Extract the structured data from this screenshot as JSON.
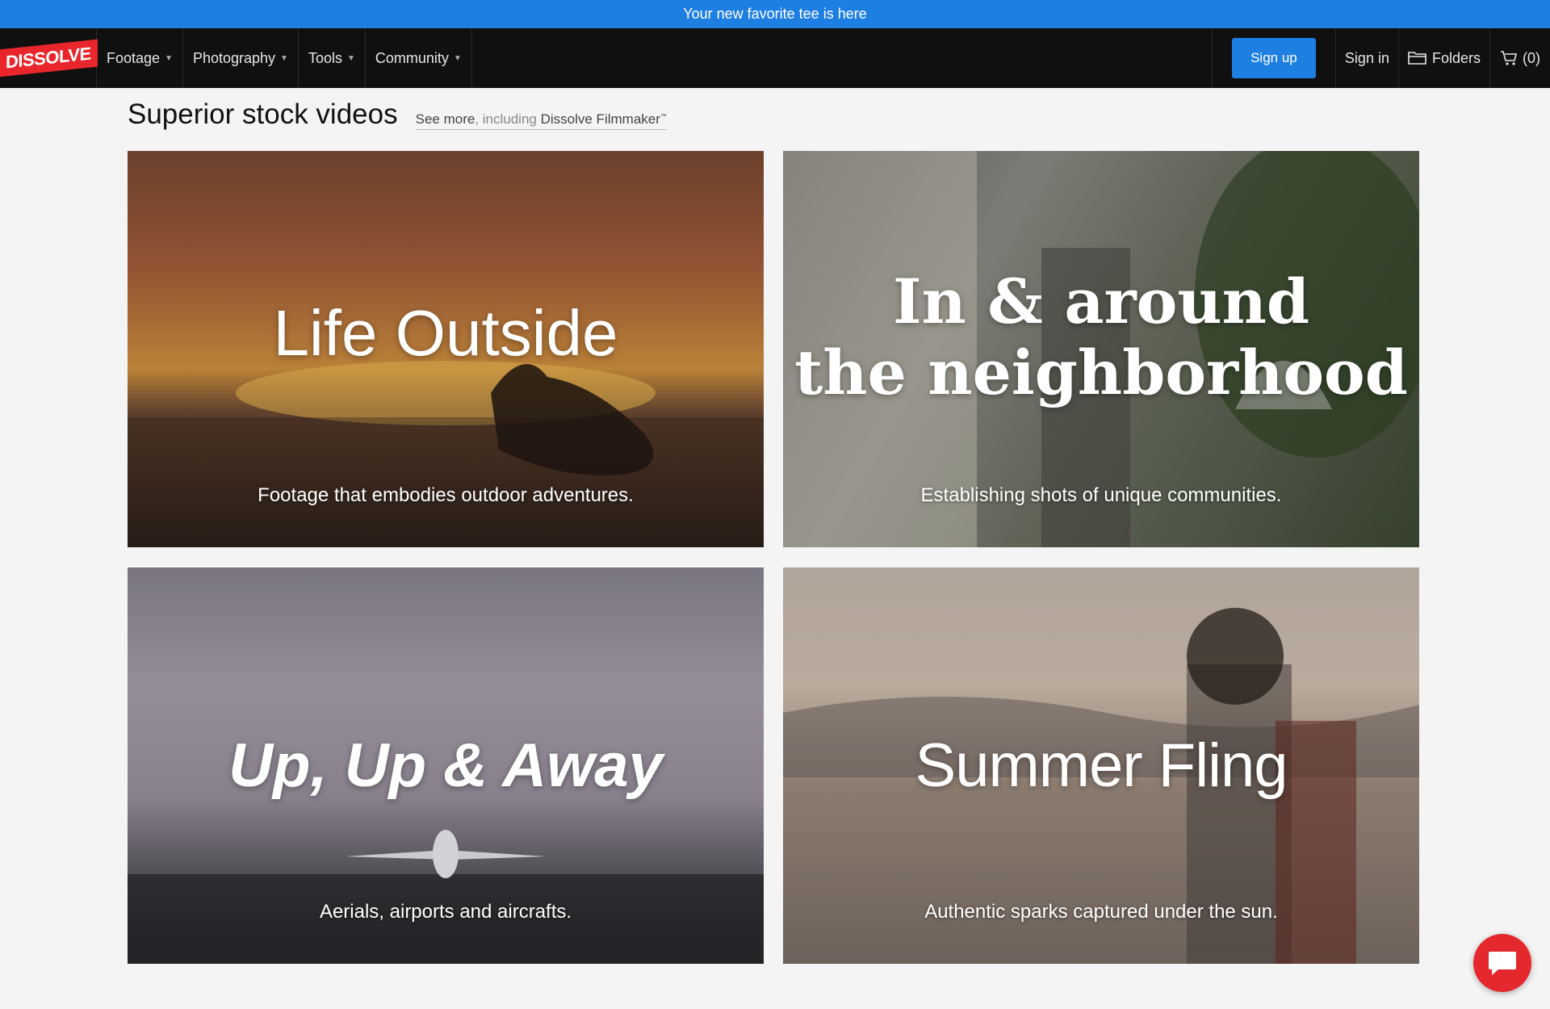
{
  "promo": {
    "text": "Your new favorite tee is here"
  },
  "nav": {
    "logo": "DISSOLVE",
    "menu": [
      {
        "label": "Footage"
      },
      {
        "label": "Photography"
      },
      {
        "label": "Tools"
      },
      {
        "label": "Community"
      }
    ],
    "signup": "Sign up",
    "signin": "Sign in",
    "folders": "Folders",
    "cart": "(0)"
  },
  "section": {
    "title": "Superior stock videos",
    "see_more": "See more",
    "including": ", including ",
    "filmmaker": "Dissolve Filmmaker",
    "tm": "™"
  },
  "tiles": [
    {
      "title": "Life Outside",
      "subtitle": "Footage that embodies outdoor adventures."
    },
    {
      "title_line1": "In & around",
      "title_line2": "the neighborhood",
      "subtitle": "Establishing shots of unique communities."
    },
    {
      "title": "Up, Up & Away",
      "subtitle": "Aerials, airports and aircrafts."
    },
    {
      "title": "Summer Fling",
      "subtitle": "Authentic sparks captured under the sun."
    }
  ],
  "icons": {
    "folder": "folder-icon",
    "cart": "cart-icon",
    "chat": "chat-icon"
  },
  "colors": {
    "accent": "#1e7fe3",
    "brand": "#e8262b",
    "nav_bg": "#101010"
  }
}
